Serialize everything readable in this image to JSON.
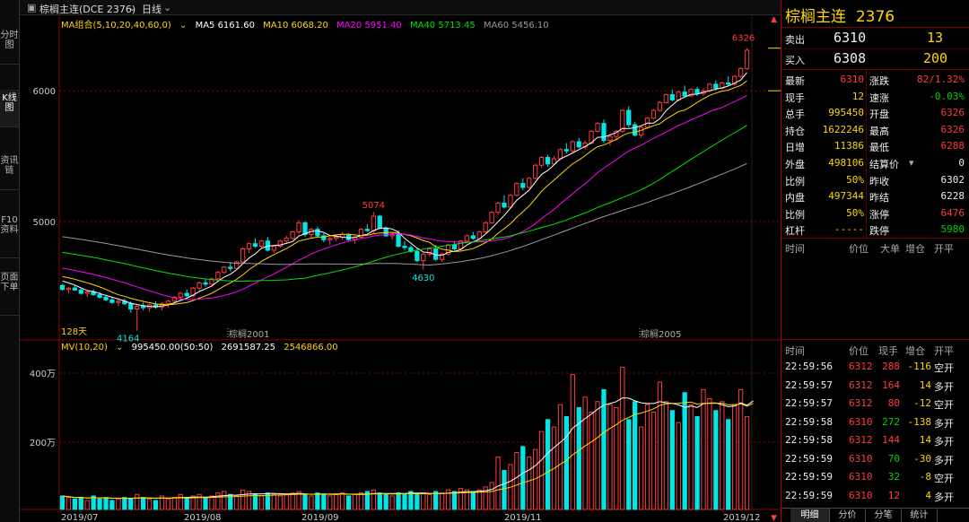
{
  "left_tabs": [
    "分时图",
    "K线图",
    "资讯链",
    "F10资料",
    "页面下单"
  ],
  "active_tab": "K线图",
  "topbar": {
    "icon_label": "▣",
    "symbol": "棕榈主连(DCE 2376)",
    "dropdown_icon": "chevron-down-icon",
    "period": "日线"
  },
  "ma_legend": {
    "group": "MA组合(5,10,20,40,60,0)",
    "items": [
      {
        "label": "MA5 6161.60",
        "color": "#ffffff"
      },
      {
        "label": "MA10 6068.20",
        "color": "#ffd400"
      },
      {
        "label": "MA20 5951.40",
        "color": "#ff00ff"
      },
      {
        "label": "MA40 5713.45",
        "color": "#00e000"
      },
      {
        "label": "MA60 5456.10",
        "color": "#9a9a9a"
      }
    ]
  },
  "mv_legend": {
    "group": "MV(10,20)",
    "items": [
      {
        "label": "995450.00(50:50)",
        "color": "#ffffff"
      },
      {
        "label": "2691587.25",
        "color": "#ffffff"
      },
      {
        "label": "2546866.00",
        "color": "#ffd400"
      }
    ]
  },
  "price_axis": {
    "labels": [
      "6000",
      "5000"
    ]
  },
  "volume_axis": {
    "labels": [
      "400万",
      "200万"
    ]
  },
  "date_axis": [
    "2019/07",
    "2019/08",
    "2019/09",
    "2019/11",
    "2019/12"
  ],
  "annotations": {
    "high_peak": "6326",
    "mid_high": "5074",
    "mid_low": "4630",
    "low": "4164",
    "days": "128天",
    "contract_1": "棕榈2001",
    "contract_2": "棕榈2005"
  },
  "colors": {
    "up": "#ff3b3b",
    "down": "#00e5e5",
    "panel_border": "#a00000",
    "grid": "#8b0000"
  },
  "chart_data": {
    "type": "candlestick",
    "candles": [
      [
        4510,
        4520,
        4470,
        4480
      ],
      [
        4480,
        4500,
        4450,
        4490
      ],
      [
        4490,
        4510,
        4470,
        4475
      ],
      [
        4475,
        4490,
        4440,
        4450
      ],
      [
        4450,
        4470,
        4420,
        4460
      ],
      [
        4460,
        4480,
        4430,
        4440
      ],
      [
        4440,
        4460,
        4410,
        4420
      ],
      [
        4420,
        4440,
        4390,
        4400
      ],
      [
        4400,
        4420,
        4370,
        4380
      ],
      [
        4380,
        4400,
        4350,
        4390
      ],
      [
        4390,
        4410,
        4360,
        4370
      ],
      [
        4370,
        4390,
        4300,
        4330
      ],
      [
        4330,
        4360,
        4164,
        4350
      ],
      [
        4350,
        4380,
        4320,
        4340
      ],
      [
        4340,
        4370,
        4310,
        4360
      ],
      [
        4360,
        4390,
        4330,
        4345
      ],
      [
        4345,
        4380,
        4320,
        4370
      ],
      [
        4370,
        4400,
        4340,
        4390
      ],
      [
        4390,
        4430,
        4370,
        4420
      ],
      [
        4420,
        4460,
        4400,
        4450
      ],
      [
        4450,
        4480,
        4420,
        4430
      ],
      [
        4430,
        4500,
        4420,
        4490
      ],
      [
        4490,
        4540,
        4470,
        4530
      ],
      [
        4530,
        4560,
        4500,
        4520
      ],
      [
        4520,
        4570,
        4510,
        4560
      ],
      [
        4560,
        4620,
        4550,
        4610
      ],
      [
        4610,
        4660,
        4600,
        4650
      ],
      [
        4650,
        4690,
        4620,
        4640
      ],
      [
        4640,
        4700,
        4630,
        4690
      ],
      [
        4690,
        4800,
        4680,
        4790
      ],
      [
        4790,
        4840,
        4760,
        4830
      ],
      [
        4830,
        4870,
        4800,
        4810
      ],
      [
        4810,
        4860,
        4790,
        4850
      ],
      [
        4850,
        4880,
        4770,
        4780
      ],
      [
        4780,
        4820,
        4760,
        4810
      ],
      [
        4810,
        4860,
        4800,
        4850
      ],
      [
        4850,
        4890,
        4830,
        4870
      ],
      [
        4870,
        4930,
        4860,
        4920
      ],
      [
        4920,
        5010,
        4900,
        4990
      ],
      [
        4990,
        5000,
        4880,
        4900
      ],
      [
        4900,
        4950,
        4870,
        4940
      ],
      [
        4940,
        4960,
        4880,
        4890
      ],
      [
        4890,
        4910,
        4840,
        4860
      ],
      [
        4860,
        4880,
        4820,
        4870
      ],
      [
        4870,
        4900,
        4850,
        4880
      ],
      [
        4880,
        4920,
        4860,
        4900
      ],
      [
        4900,
        4910,
        4850,
        4860
      ],
      [
        4860,
        4890,
        4830,
        4880
      ],
      [
        4880,
        4950,
        4870,
        4940
      ],
      [
        4940,
        4980,
        4920,
        4930
      ],
      [
        4930,
        5074,
        4910,
        5040
      ],
      [
        5040,
        5050,
        4940,
        4950
      ],
      [
        4950,
        4960,
        4880,
        4890
      ],
      [
        4890,
        4920,
        4860,
        4900
      ],
      [
        4900,
        4930,
        4800,
        4810
      ],
      [
        4810,
        4850,
        4780,
        4800
      ],
      [
        4800,
        4820,
        4760,
        4770
      ],
      [
        4770,
        4790,
        4690,
        4700
      ],
      [
        4700,
        4760,
        4630,
        4750
      ],
      [
        4750,
        4800,
        4730,
        4790
      ],
      [
        4790,
        4820,
        4700,
        4710
      ],
      [
        4710,
        4760,
        4690,
        4750
      ],
      [
        4750,
        4830,
        4740,
        4820
      ],
      [
        4820,
        4850,
        4780,
        4790
      ],
      [
        4790,
        4860,
        4780,
        4850
      ],
      [
        4850,
        4900,
        4840,
        4890
      ],
      [
        4890,
        4920,
        4860,
        4870
      ],
      [
        4870,
        4930,
        4860,
        4920
      ],
      [
        4920,
        5000,
        4910,
        4990
      ],
      [
        4990,
        5080,
        4980,
        5070
      ],
      [
        5070,
        5150,
        5050,
        5140
      ],
      [
        5140,
        5200,
        5100,
        5110
      ],
      [
        5110,
        5210,
        5100,
        5200
      ],
      [
        5200,
        5300,
        5190,
        5290
      ],
      [
        5290,
        5330,
        5240,
        5260
      ],
      [
        5260,
        5340,
        5250,
        5330
      ],
      [
        5330,
        5440,
        5320,
        5430
      ],
      [
        5430,
        5500,
        5410,
        5490
      ],
      [
        5490,
        5510,
        5420,
        5440
      ],
      [
        5440,
        5500,
        5430,
        5480
      ],
      [
        5480,
        5560,
        5470,
        5550
      ],
      [
        5550,
        5600,
        5520,
        5540
      ],
      [
        5540,
        5620,
        5530,
        5610
      ],
      [
        5610,
        5640,
        5560,
        5570
      ],
      [
        5570,
        5620,
        5550,
        5600
      ],
      [
        5600,
        5700,
        5590,
        5690
      ],
      [
        5690,
        5760,
        5680,
        5750
      ],
      [
        5750,
        5780,
        5600,
        5620
      ],
      [
        5620,
        5660,
        5580,
        5650
      ],
      [
        5650,
        5700,
        5620,
        5690
      ],
      [
        5690,
        5860,
        5680,
        5850
      ],
      [
        5850,
        5880,
        5720,
        5740
      ],
      [
        5740,
        5760,
        5650,
        5660
      ],
      [
        5660,
        5730,
        5640,
        5720
      ],
      [
        5720,
        5800,
        5710,
        5790
      ],
      [
        5790,
        5860,
        5780,
        5850
      ],
      [
        5850,
        5920,
        5840,
        5910
      ],
      [
        5910,
        5980,
        5900,
        5970
      ],
      [
        5970,
        6010,
        5920,
        5930
      ],
      [
        5930,
        6000,
        5920,
        5990
      ],
      [
        5990,
        6040,
        5950,
        5960
      ],
      [
        5960,
        6020,
        5950,
        6010
      ],
      [
        6010,
        6030,
        5960,
        5980
      ],
      [
        5980,
        6020,
        5960,
        6000
      ],
      [
        6000,
        6060,
        5990,
        6050
      ],
      [
        6050,
        6080,
        6000,
        6020
      ],
      [
        6020,
        6070,
        6010,
        6060
      ],
      [
        6060,
        6110,
        6040,
        6050
      ],
      [
        6050,
        6120,
        6040,
        6110
      ],
      [
        6110,
        6180,
        6100,
        6170
      ],
      [
        6170,
        6326,
        6160,
        6310
      ]
    ],
    "volume_ratio": [
      0.09,
      0.08,
      0.07,
      0.08,
      0.06,
      0.09,
      0.07,
      0.08,
      0.06,
      0.07,
      0.08,
      0.07,
      0.1,
      0.08,
      0.07,
      0.06,
      0.09,
      0.07,
      0.08,
      0.1,
      0.08,
      0.09,
      0.1,
      0.08,
      0.09,
      0.11,
      0.12,
      0.1,
      0.09,
      0.13,
      0.12,
      0.1,
      0.09,
      0.11,
      0.1,
      0.09,
      0.1,
      0.11,
      0.12,
      0.1,
      0.09,
      0.11,
      0.1,
      0.09,
      0.1,
      0.11,
      0.09,
      0.1,
      0.11,
      0.12,
      0.13,
      0.11,
      0.1,
      0.09,
      0.11,
      0.1,
      0.12,
      0.1,
      0.11,
      0.1,
      0.12,
      0.11,
      0.13,
      0.12,
      0.14,
      0.13,
      0.12,
      0.13,
      0.15,
      0.18,
      0.35,
      0.26,
      0.3,
      0.38,
      0.42,
      0.35,
      0.4,
      0.52,
      0.6,
      0.55,
      0.7,
      0.62,
      0.9,
      0.68,
      0.75,
      0.65,
      0.72,
      0.8,
      0.7,
      0.68,
      0.95,
      0.6,
      0.72,
      0.55,
      0.7,
      0.65,
      0.85,
      0.72,
      0.66,
      0.58,
      0.78,
      0.7,
      0.62,
      0.8,
      0.74,
      0.66,
      0.72,
      0.6,
      0.7,
      0.8,
      0.62,
      0.98
    ]
  },
  "quote": {
    "title": "棕榈主连",
    "code": "2376",
    "ask": {
      "label": "卖出",
      "price": "6310",
      "vol": "13"
    },
    "bid": {
      "label": "买入",
      "price": "6308",
      "vol": "200"
    },
    "rows": [
      {
        "l1": "最新",
        "v1": "6310",
        "c1": "red",
        "l2": "涨跌",
        "v2": "82/1.32%",
        "c2": "red"
      },
      {
        "l1": "现手",
        "v1": "12",
        "c1": "yellow",
        "l2": "速涨",
        "v2": "-0.03%",
        "c2": "green"
      },
      {
        "l1": "总手",
        "v1": "995450",
        "c1": "yellow",
        "l2": "开盘",
        "v2": "6326",
        "c2": "red"
      },
      {
        "l1": "持仓",
        "v1": "1622246",
        "c1": "yellow",
        "l2": "最高",
        "v2": "6326",
        "c2": "red"
      },
      {
        "l1": "日增",
        "v1": "11386",
        "c1": "yellow",
        "l2": "最低",
        "v2": "6288",
        "c2": "red"
      },
      {
        "l1": "外盘",
        "v1": "498106",
        "c1": "yellow",
        "l2": "结算价",
        "v2": "0",
        "c2": "white"
      },
      {
        "l1": "比例",
        "v1": "50%",
        "c1": "yellow",
        "l2": "昨收",
        "v2": "6302",
        "c2": "white"
      },
      {
        "l1": "内盘",
        "v1": "497344",
        "c1": "yellow",
        "l2": "昨结",
        "v2": "6228",
        "c2": "white"
      },
      {
        "l1": "比例",
        "v1": "50%",
        "c1": "yellow",
        "l2": "涨停",
        "v2": "6476",
        "c2": "red"
      },
      {
        "l1": "杠杆",
        "v1": "-----",
        "c1": "yellow",
        "l2": "跌停",
        "v2": "5980",
        "c2": "green"
      }
    ],
    "trade_header_1": [
      "时间",
      "价位",
      "大单",
      "增仓",
      "开平"
    ],
    "trade_header_2": [
      "时间",
      "价位",
      "现手",
      "增仓",
      "开平"
    ],
    "ticks": [
      {
        "t": "22:59:56",
        "p": "6312",
        "pc": "red",
        "v": "288",
        "vc": "red",
        "d": "-116",
        "dc": "yellow",
        "k": "空开"
      },
      {
        "t": "22:59:57",
        "p": "6312",
        "pc": "red",
        "v": "164",
        "vc": "red",
        "d": "14",
        "dc": "yellow",
        "k": "多开"
      },
      {
        "t": "22:59:57",
        "p": "6312",
        "pc": "red",
        "v": "80",
        "vc": "red",
        "d": "-12",
        "dc": "yellow",
        "k": "空开"
      },
      {
        "t": "22:59:58",
        "p": "6310",
        "pc": "red",
        "v": "272",
        "vc": "green",
        "d": "-138",
        "dc": "yellow",
        "k": "多开"
      },
      {
        "t": "22:59:58",
        "p": "6312",
        "pc": "red",
        "v": "144",
        "vc": "red",
        "d": "14",
        "dc": "yellow",
        "k": "多开"
      },
      {
        "t": "22:59:59",
        "p": "6310",
        "pc": "red",
        "v": "70",
        "vc": "green",
        "d": "-30",
        "dc": "yellow",
        "k": "多开"
      },
      {
        "t": "22:59:59",
        "p": "6310",
        "pc": "red",
        "v": "32",
        "vc": "green",
        "d": "-8",
        "dc": "yellow",
        "k": "空开"
      },
      {
        "t": "22:59:59",
        "p": "6310",
        "pc": "red",
        "v": "12",
        "vc": "red",
        "d": "4",
        "dc": "yellow",
        "k": "多开"
      }
    ],
    "bottom_tabs": [
      "明细",
      "分价",
      "分笔",
      "统计"
    ]
  }
}
